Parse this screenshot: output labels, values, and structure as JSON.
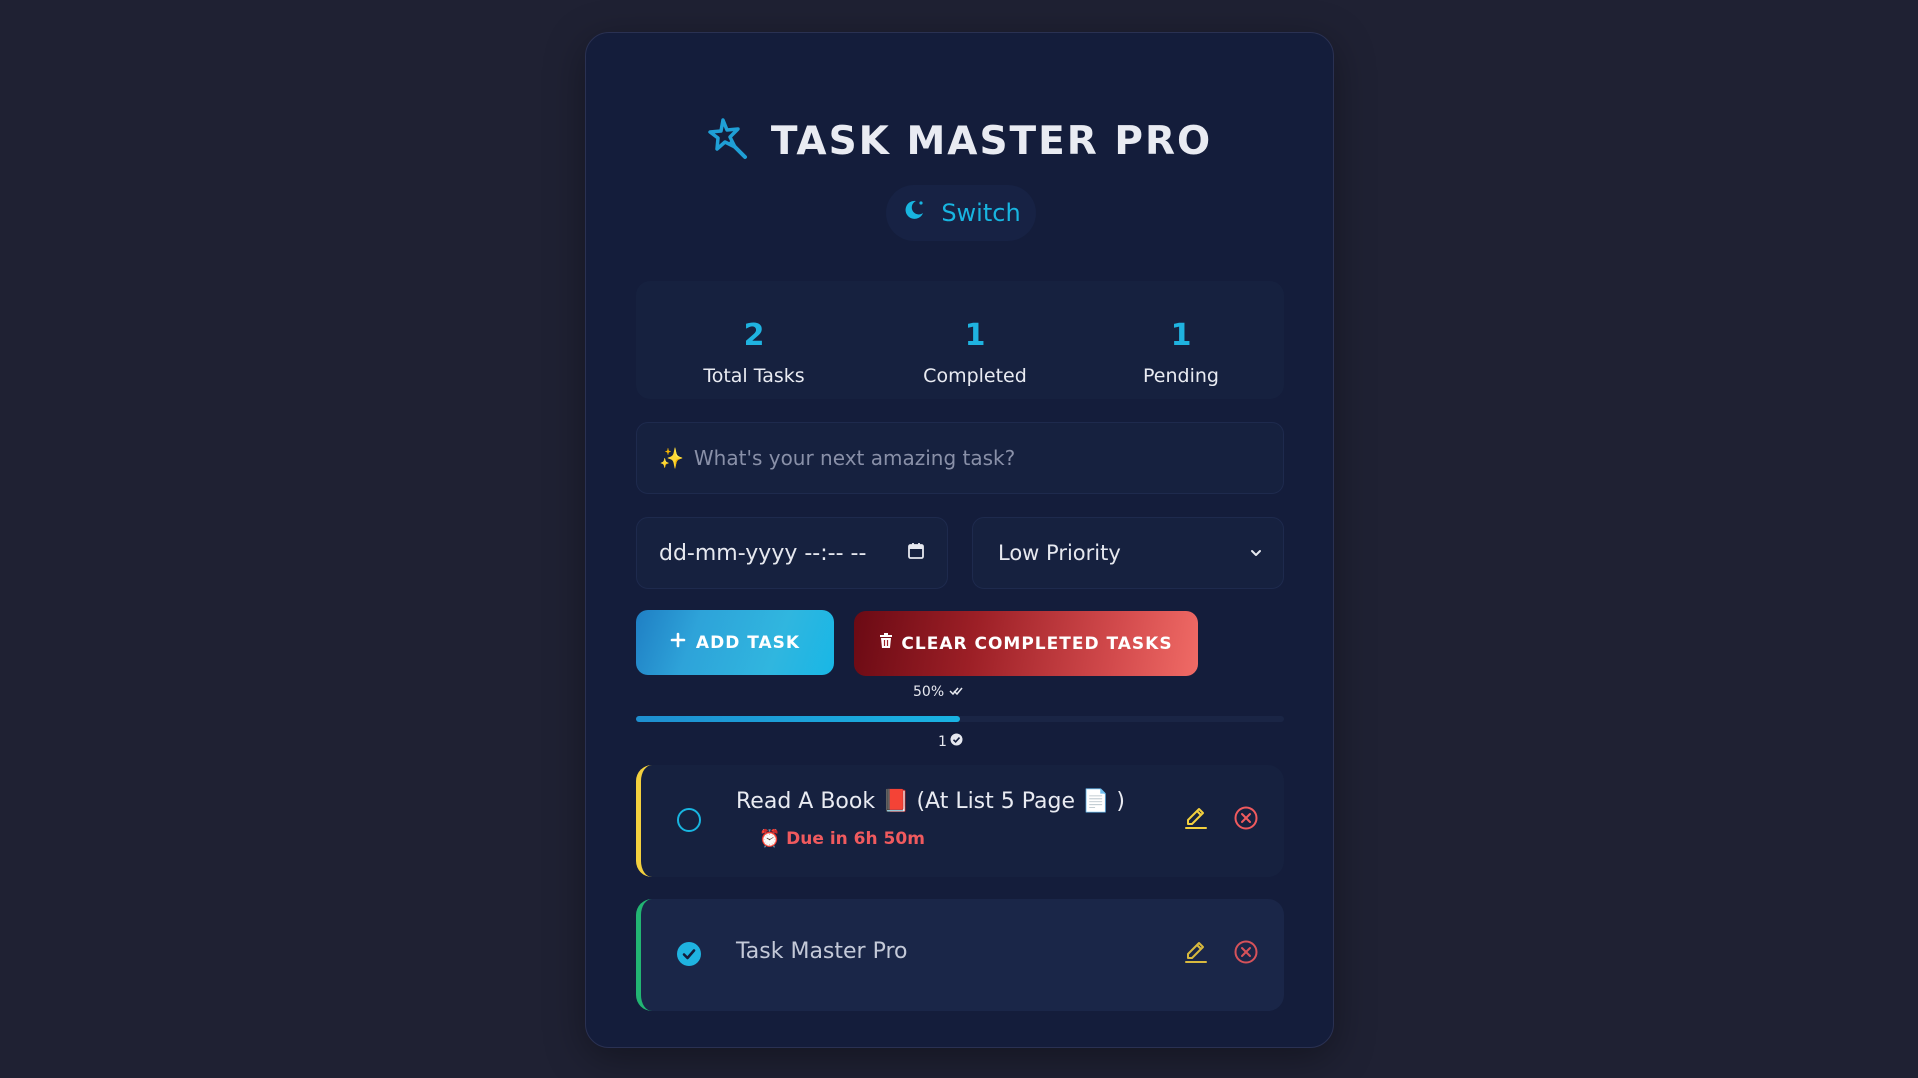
{
  "app": {
    "title": "TASK MASTER PRO"
  },
  "theme_toggle": {
    "label": "Switch",
    "icon": "moon-icon"
  },
  "stats": {
    "total": {
      "value": "2",
      "label": "Total Tasks"
    },
    "completed": {
      "value": "1",
      "label": "Completed"
    },
    "pending": {
      "value": "1",
      "label": "Pending"
    }
  },
  "new_task": {
    "prefix_icon": "✨",
    "placeholder": "What's your next amazing task?",
    "value": ""
  },
  "due_date": {
    "placeholder": "dd-mm-yyyy --:-- --",
    "icon": "calendar-icon"
  },
  "priority": {
    "selected": "Low Priority",
    "options": [
      "Low Priority"
    ]
  },
  "buttons": {
    "add": "ADD TASK",
    "clear": "CLEAR COMPLETED TASKS"
  },
  "progress": {
    "percent_label": "50%",
    "fraction": 0.5,
    "completed_count": "1"
  },
  "tasks": [
    {
      "text": "Read A Book 📕 (At List 5 Page 📄 )",
      "completed": false,
      "priority_color": "#f3d03e",
      "due_icon": "⏰",
      "due_text": "Due in 6h 50m"
    },
    {
      "text": "Task Master Pro",
      "completed": true,
      "priority_color": "#22b573"
    }
  ],
  "colors": {
    "accent": "#18b5e0",
    "danger": "#f05a5e",
    "edit": "#f3d03e",
    "background": "#1f2133",
    "card": "#141d3b"
  }
}
